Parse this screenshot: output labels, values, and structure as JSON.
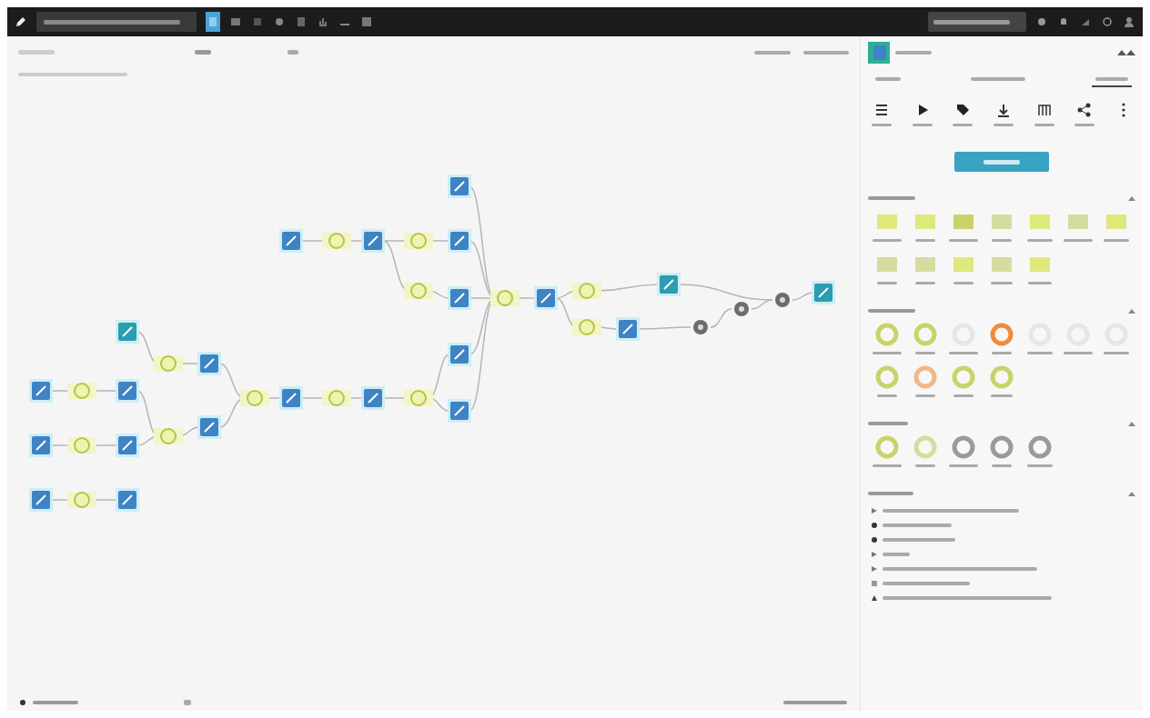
{
  "flow": {
    "nodes": [
      {
        "kind": "dataset"
      },
      {
        "kind": "dataset"
      },
      {
        "kind": "dataset"
      },
      {
        "kind": "dataset"
      },
      {
        "kind": "dataset"
      },
      {
        "kind": "dataset"
      },
      {
        "kind": "dataset"
      },
      {
        "kind": "dataset"
      },
      {
        "kind": "dataset"
      },
      {
        "kind": "dataset"
      },
      {
        "kind": "dataset"
      },
      {
        "kind": "dataset"
      },
      {
        "kind": "dataset"
      },
      {
        "kind": "dataset"
      },
      {
        "kind": "dataset"
      },
      {
        "kind": "dataset"
      },
      {
        "kind": "dataset"
      },
      {
        "kind": "dataset"
      },
      {
        "kind": "dataset"
      },
      {
        "kind": "dataset"
      },
      {
        "kind": "dataset"
      },
      {
        "kind": "dataset"
      },
      {
        "kind": "recipe"
      },
      {
        "kind": "recipe"
      },
      {
        "kind": "recipe"
      },
      {
        "kind": "recipe"
      },
      {
        "kind": "recipe"
      },
      {
        "kind": "recipe"
      },
      {
        "kind": "recipe"
      },
      {
        "kind": "recipe"
      },
      {
        "kind": "recipe"
      },
      {
        "kind": "recipe"
      },
      {
        "kind": "recipe"
      },
      {
        "kind": "recipe"
      },
      {
        "kind": "recipe"
      },
      {
        "kind": "recipe"
      },
      {
        "kind": "model"
      },
      {
        "kind": "model"
      },
      {
        "kind": "model"
      }
    ]
  },
  "panel": {
    "tabs": [
      {
        "selected": false
      },
      {
        "selected": false
      },
      {
        "selected": true
      }
    ],
    "sections": [
      {
        "expanded": true,
        "tiles": [
          {
            "color": "#dfe87a"
          },
          {
            "color": "#dfe87a"
          },
          {
            "color": "#c9d36a"
          },
          {
            "color": "#d6dca0"
          },
          {
            "color": "#dfe87a"
          },
          {
            "color": "#d6dca0"
          },
          {
            "color": "#dfe87a"
          },
          {
            "color": "#d6dca0"
          },
          {
            "color": "#d6dca0"
          },
          {
            "color": "#dfe87a"
          },
          {
            "color": "#d6dca0"
          },
          {
            "color": "#dfe87a"
          }
        ]
      },
      {
        "expanded": true,
        "tiles": [
          {
            "color": "#c9d36a"
          },
          {
            "color": "#c9d36a"
          },
          {
            "color": "#e6e6e6"
          },
          {
            "color": "#f08a3c"
          },
          {
            "color": "#e6e6e6"
          },
          {
            "color": "#e6e6e6"
          },
          {
            "color": "#e6e6e6"
          },
          {
            "color": "#c9d36a"
          },
          {
            "color": "#f0b88a"
          },
          {
            "color": "#c9d36a"
          },
          {
            "color": "#c9d36a"
          }
        ]
      },
      {
        "expanded": true,
        "tiles": [
          {
            "color": "#c9d36a"
          },
          {
            "color": "#d6dca0"
          },
          {
            "color": "#9a9a9a"
          },
          {
            "color": "#9a9a9a"
          },
          {
            "color": "#9a9a9a"
          }
        ]
      },
      {
        "expanded": true,
        "items": [
          {
            "kind": "arrow"
          },
          {
            "kind": "dot"
          },
          {
            "kind": "dot"
          },
          {
            "kind": "arrow"
          },
          {
            "kind": "arrow"
          },
          {
            "kind": "square"
          },
          {
            "kind": "triangle"
          }
        ]
      }
    ]
  }
}
